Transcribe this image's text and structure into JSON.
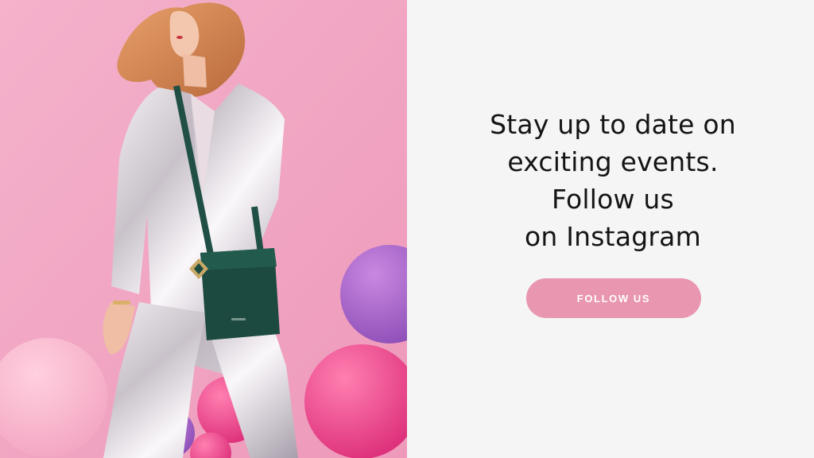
{
  "promo": {
    "photo_alt": "Woman in metallic silver suit with green crossbody bag among balloons",
    "headline_lines": [
      "Stay up to date on",
      "exciting events.",
      "Follow us",
      "on Instagram"
    ],
    "button_label": "FOLLOW US"
  },
  "colors": {
    "photo_background": "#f1a7c4",
    "panel_background": "#f5f5f5",
    "headline_text": "#141414",
    "button_background": "#e996b0",
    "button_text": "#ffffff"
  }
}
